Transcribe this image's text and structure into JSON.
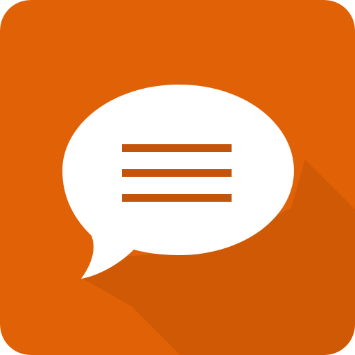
{
  "icon": {
    "name": "chat-bubble-icon",
    "background_color": "#E06106",
    "bubble_color": "#FFFFFF",
    "line_color": "#C3540C",
    "shadow_color": "#B04B06",
    "menu_line_count": 3
  }
}
